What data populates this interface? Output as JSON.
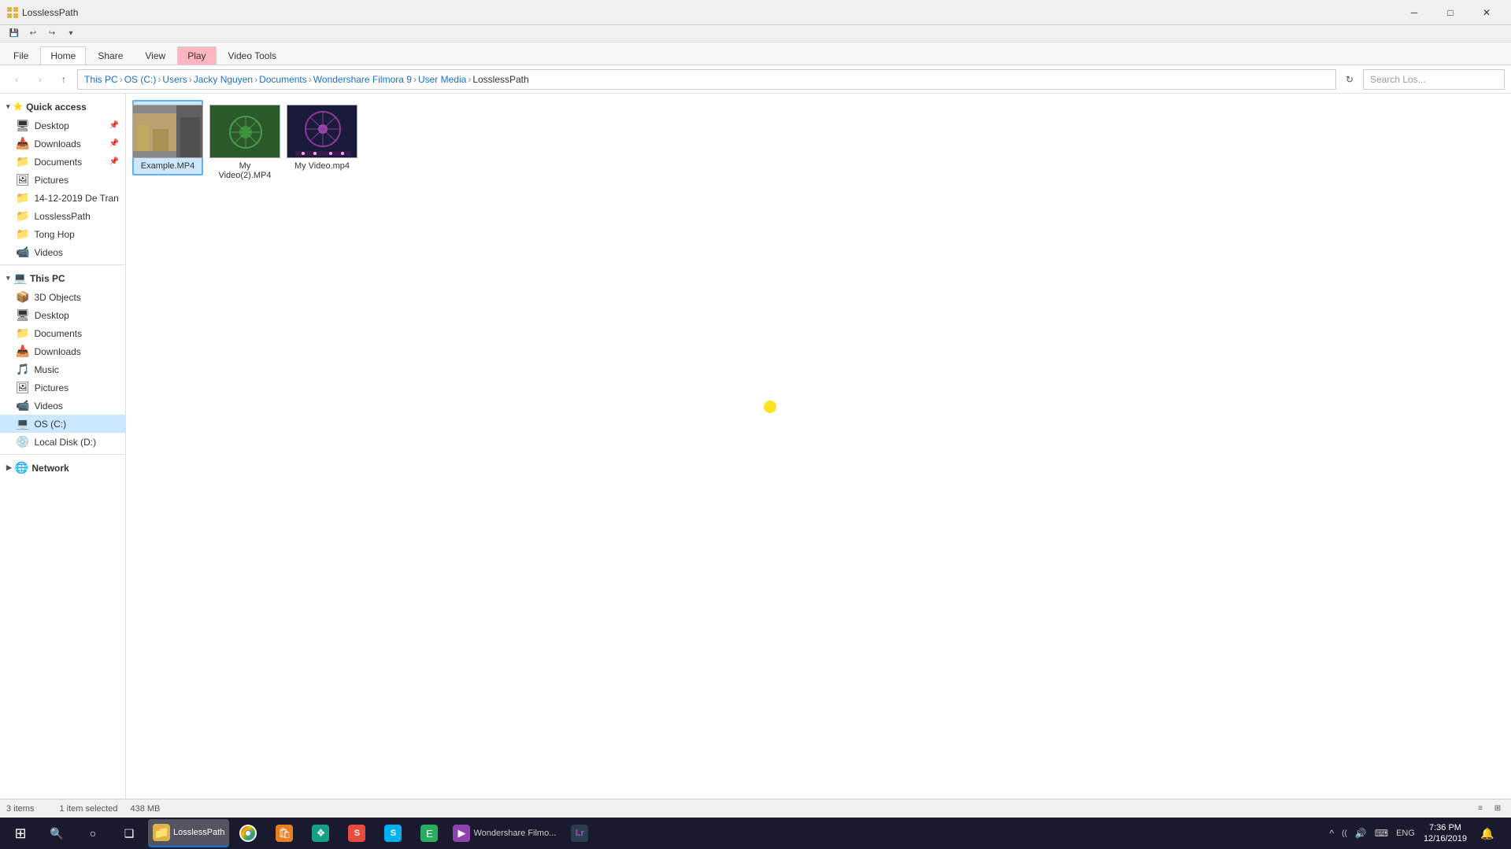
{
  "titlebar": {
    "title": "LosslessPath",
    "minimize": "─",
    "maximize": "□",
    "close": "✕"
  },
  "quicktoolbar": {
    "save_label": "💾",
    "undo_label": "↩",
    "redo_label": "↪",
    "dropdown": "▾"
  },
  "ribbon": {
    "tabs": [
      {
        "id": "file",
        "label": "File",
        "active": false
      },
      {
        "id": "home",
        "label": "Home",
        "active": true
      },
      {
        "id": "share",
        "label": "Share",
        "active": false
      },
      {
        "id": "view",
        "label": "View",
        "active": false
      },
      {
        "id": "videotools",
        "label": "Video Tools",
        "active": false
      }
    ],
    "play_tab": "Play"
  },
  "addressbar": {
    "back": "‹",
    "forward": "›",
    "up": "↑",
    "breadcrumbs": [
      "This PC",
      "OS (C:)",
      "Users",
      "Jacky Nguyen",
      "Documents",
      "Wondershare Filmora 9",
      "User Media",
      "LosslessPath"
    ],
    "refresh": "↻",
    "search_placeholder": "Search Los..."
  },
  "sidebar": {
    "quick_access_label": "Quick access",
    "items_quick": [
      {
        "id": "desktop",
        "label": "Desktop",
        "pinned": true,
        "icon": "🖥"
      },
      {
        "id": "downloads",
        "label": "Downloads",
        "pinned": true,
        "icon": "📥"
      },
      {
        "id": "documents",
        "label": "Documents",
        "pinned": true,
        "icon": "📁"
      },
      {
        "id": "pictures",
        "label": "Pictures",
        "pinned": false,
        "icon": "🖼"
      },
      {
        "id": "14-12",
        "label": "14-12-2019 De Tran",
        "pinned": false,
        "icon": "📁"
      },
      {
        "id": "losslesspath",
        "label": "LosslessPath",
        "pinned": false,
        "icon": "📁"
      },
      {
        "id": "tonghop",
        "label": "Tong Hop",
        "pinned": false,
        "icon": "📁"
      },
      {
        "id": "videos",
        "label": "Videos",
        "pinned": false,
        "icon": "📹"
      }
    ],
    "this_pc_label": "This PC",
    "items_pc": [
      {
        "id": "3dobjects",
        "label": "3D Objects",
        "icon": "📦"
      },
      {
        "id": "desktop2",
        "label": "Desktop",
        "icon": "🖥"
      },
      {
        "id": "documents2",
        "label": "Documents",
        "icon": "📁"
      },
      {
        "id": "downloads2",
        "label": "Downloads",
        "icon": "📥"
      },
      {
        "id": "music",
        "label": "Music",
        "icon": "🎵"
      },
      {
        "id": "pictures2",
        "label": "Pictures",
        "icon": "🖼"
      },
      {
        "id": "videos2",
        "label": "Videos",
        "icon": "📹"
      },
      {
        "id": "osc",
        "label": "OS (C:)",
        "icon": "💻",
        "selected": true
      },
      {
        "id": "locald",
        "label": "Local Disk (D:)",
        "icon": "💿"
      }
    ],
    "network_label": "Network",
    "network_icon": "🌐"
  },
  "files": [
    {
      "id": "example",
      "name": "Example.MP4",
      "selected": true,
      "checked": true,
      "thumb_class": "thumb-example"
    },
    {
      "id": "myvideo2",
      "name": "My Video(2).MP4",
      "selected": false,
      "checked": false,
      "thumb_class": "thumb-myvideo2"
    },
    {
      "id": "myvideo",
      "name": "My Video.mp4",
      "selected": false,
      "checked": false,
      "thumb_class": "thumb-myvideo"
    }
  ],
  "statusbar": {
    "item_count": "3 items",
    "selection": "1 item selected",
    "size": "438 MB",
    "view_list": "≡",
    "view_details": "⊞"
  },
  "taskbar": {
    "start_icon": "⊞",
    "search_icon": "🔍",
    "cortana_icon": "○",
    "taskview_icon": "❑",
    "apps": [
      {
        "id": "explorer",
        "label": "LosslessPath",
        "icon": "📁",
        "active": true,
        "color": "#dcb44c"
      },
      {
        "id": "chrome",
        "label": "",
        "icon": "●",
        "color": "#e74c3c"
      },
      {
        "id": "store",
        "label": "",
        "icon": "🛍",
        "color": "#e67e22"
      },
      {
        "id": "app4",
        "label": "",
        "icon": "❖",
        "color": "#16a085"
      },
      {
        "id": "app5",
        "label": "",
        "icon": "▣",
        "color": "#3498db"
      },
      {
        "id": "app6",
        "label": "",
        "icon": "S",
        "color": "#e74c3c"
      },
      {
        "id": "skype",
        "label": "",
        "icon": "S",
        "color": "#c0392b"
      },
      {
        "id": "app8",
        "label": "",
        "icon": "E",
        "color": "#27ae60"
      },
      {
        "id": "filmora",
        "label": "Wondershare Filmo...",
        "icon": "▶",
        "color": "#8e44ad",
        "active": false
      },
      {
        "id": "lightroom",
        "label": "",
        "icon": "Lr",
        "color": "#2c3e50"
      }
    ],
    "sys_icons": [
      "^",
      "((",
      "🔊",
      "⌨"
    ],
    "lang": "ENG",
    "time": "7:36 PM",
    "date": "12/16/2019",
    "notification_icon": "🔔"
  }
}
